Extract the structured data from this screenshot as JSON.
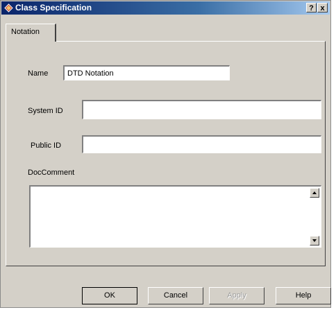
{
  "window": {
    "title": "Class Specification",
    "help_button": "?",
    "close_button": "x"
  },
  "tabs": [
    {
      "label": "Notation"
    }
  ],
  "form": {
    "name_label": "Name",
    "name_value": "DTD Notation",
    "system_id_label": "System ID",
    "system_id_value": "",
    "public_id_label": "Public ID",
    "public_id_value": "",
    "doccomment_label": "DocComment",
    "doccomment_value": ""
  },
  "buttons": {
    "ok": "OK",
    "cancel": "Cancel",
    "apply": "Apply",
    "help": "Help"
  },
  "icons": {
    "app": "class-diamond-icon",
    "scroll_up": "scroll-up-arrow-icon",
    "scroll_down": "scroll-down-arrow-icon"
  }
}
